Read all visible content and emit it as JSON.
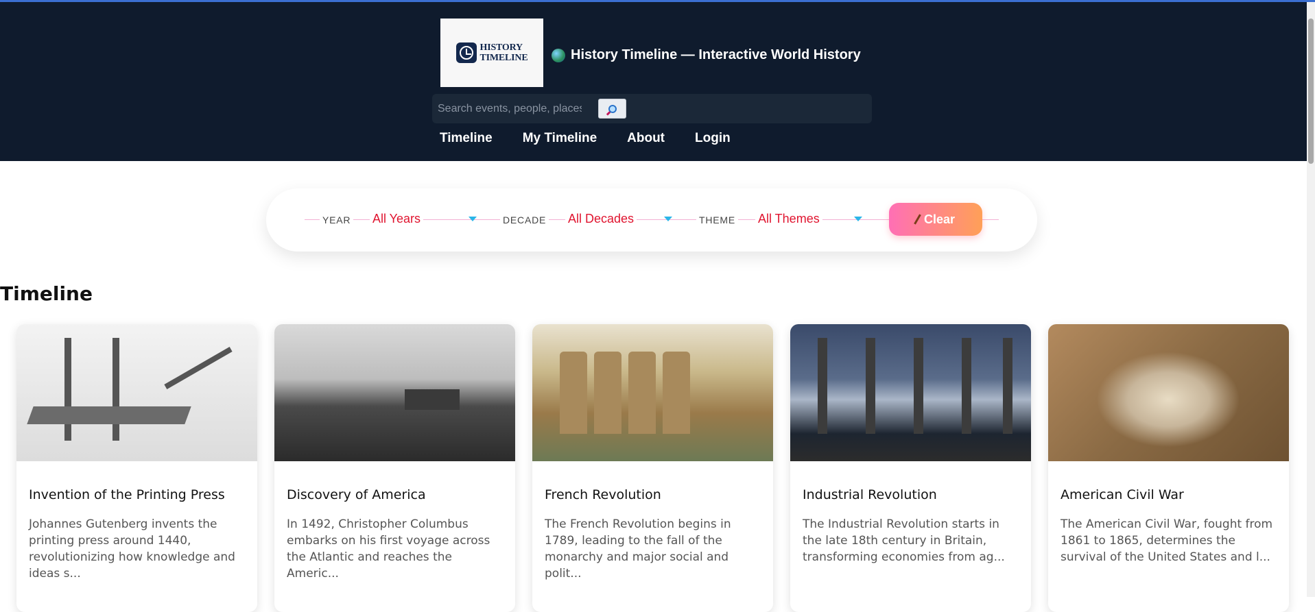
{
  "header": {
    "logo_line1": "HISTORY",
    "logo_line2": "TIMELINE",
    "title": "History Timeline — Interactive World History",
    "search_placeholder": "Search events, people, places...",
    "nav": [
      "Timeline",
      "My Timeline",
      "About",
      "Login"
    ]
  },
  "filters": {
    "year_label": "YEAR",
    "year_value": "All Years",
    "decade_label": "DECADE",
    "decade_value": "All Decades",
    "theme_label": "THEME",
    "theme_value": "All Themes",
    "clear_label": "Clear"
  },
  "section_title": "Timeline",
  "cards": [
    {
      "title": "Invention of the Printing Press",
      "desc": "Johannes Gutenberg invents the printing press around 1440, revolutionizing how knowledge and ideas s..."
    },
    {
      "title": "Discovery of America",
      "desc": "In 1492, Christopher Columbus embarks on his first voyage across the Atlantic and reaches the Americ..."
    },
    {
      "title": "French Revolution",
      "desc": "The French Revolution begins in 1789, leading to the fall of the monarchy and major social and polit..."
    },
    {
      "title": "Industrial Revolution",
      "desc": "The Industrial Revolution starts in the late 18th century in Britain, transforming economies from ag..."
    },
    {
      "title": "American Civil War",
      "desc": "The American Civil War, fought from 1861 to 1865, determines the survival of the United States and l..."
    }
  ],
  "colors": {
    "header_bg": "#0f1b2d",
    "filter_value": "#e0142f",
    "clear_gradient_start": "#ff6fb5",
    "clear_gradient_end": "#ffa057"
  }
}
